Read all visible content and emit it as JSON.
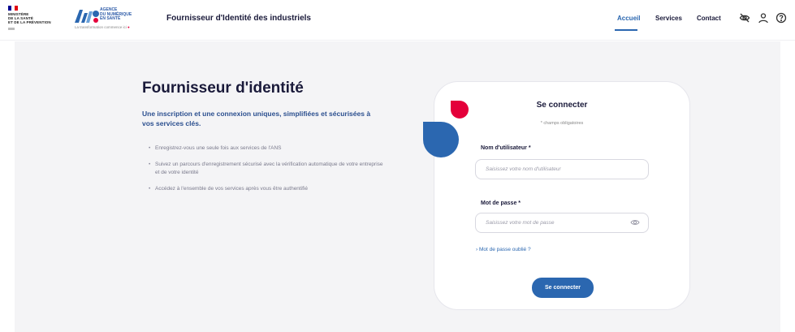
{
  "colors": {
    "primary_blue": "#2b67b0",
    "accent_red": "#e4003a",
    "page_bg": "#f4f4f6",
    "text_dark": "#1a1a3a"
  },
  "gov_logo": {
    "lines": [
      "MINISTÈRE",
      "DE LA SANTÉ",
      "ET DE LA PRÉVENTION"
    ]
  },
  "ans_logo": {
    "mark": "ANS",
    "lines": [
      "AGENCE",
      "DU NUMÉRIQUE",
      "EN SANTÉ"
    ],
    "tagline": "La transformation commence ici"
  },
  "header": {
    "title": "Fournisseur d'Identité des industriels",
    "nav": [
      "Accueil",
      "Services",
      "Contact"
    ],
    "active_nav": "Accueil",
    "icons": [
      "eye-slash-icon",
      "user-icon",
      "help-icon"
    ]
  },
  "hero": {
    "title": "Fournisseur d'identité",
    "intro": "Une inscription et une connexion uniques, simplifiées et sécurisées à vos services clés.",
    "bullets": [
      "Enregistrez-vous une seule fois aux services de l'ANS",
      "Suivez un parcours d'enregistrement sécurisé avec la vérification automatique de votre entreprise et de votre identité",
      "Accédez à l'ensemble de vos services après vous être authentifié"
    ]
  },
  "login": {
    "title": "Se connecter",
    "required_note": "* champs obligatoires",
    "username_label": "Nom d'utilisateur *",
    "username_placeholder": "Saisissez votre nom d'utilisateur",
    "password_label": "Mot de passe *",
    "password_placeholder": "Saisissez votre mot de passe",
    "forgot_link": "› Mot de passe oublié ?",
    "submit_label": "Se connecter"
  }
}
